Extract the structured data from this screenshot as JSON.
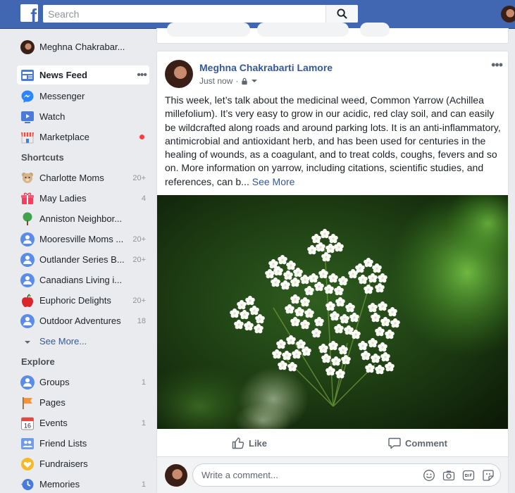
{
  "header": {
    "logo": "f",
    "search_placeholder": "Search"
  },
  "sidebar": {
    "profile_name": "Meghna Chakrabar...",
    "nav": [
      {
        "label": "News Feed",
        "more": "•••"
      },
      {
        "label": "Messenger"
      },
      {
        "label": "Watch"
      },
      {
        "label": "Marketplace"
      }
    ],
    "shortcuts_title": "Shortcuts",
    "shortcuts": [
      {
        "label": "Charlotte Moms",
        "count": "20+"
      },
      {
        "label": "May Ladies",
        "count": "4"
      },
      {
        "label": "Anniston Neighbor...",
        "count": ""
      },
      {
        "label": "Mooresville Moms ...",
        "count": "20+"
      },
      {
        "label": "Outlander Series B...",
        "count": "20+"
      },
      {
        "label": "Canadians Living i...",
        "count": ""
      },
      {
        "label": "Euphoric Delights",
        "count": "20+"
      },
      {
        "label": "Outdoor Adventures",
        "count": "18"
      }
    ],
    "see_more": "See More...",
    "explore_title": "Explore",
    "explore": [
      {
        "label": "Groups",
        "count": "1"
      },
      {
        "label": "Pages",
        "count": ""
      },
      {
        "label": "Events",
        "count": "1",
        "icon_text": "16"
      },
      {
        "label": "Friend Lists",
        "count": ""
      },
      {
        "label": "Fundraisers",
        "count": ""
      },
      {
        "label": "Memories",
        "count": "1"
      }
    ]
  },
  "post": {
    "author": "Meghna Chakrabarti Lamore",
    "time": "Just now",
    "separator": "·",
    "more": "•••",
    "text": "This week, let’s talk about the medicinal weed, Common Yarrow (Achillea millefolium). It’s very easy to grow in our acidic, red clay soil, and can easily be wildcrafted along roads and around parking lots. It is an anti-inflammatory, antimicrobial and antioxidant herb, and has been used for centuries in the healing of wounds, as a coagulant, and to treat colds, coughs, fevers and so on. More information on yarrow, including citations, scientific studies, and references, can b...",
    "see_more": "See More",
    "like_label": "Like",
    "comment_label": "Comment",
    "comment_placeholder": "Write a comment..."
  },
  "icons": {
    "search": "search-icon",
    "privacy": "lock-icon",
    "like": "thumbs-up-icon",
    "comment": "speech-bubble-icon"
  },
  "colors": {
    "brand": "#4267b2",
    "link": "#365899",
    "notification": "#fa3e3e"
  }
}
